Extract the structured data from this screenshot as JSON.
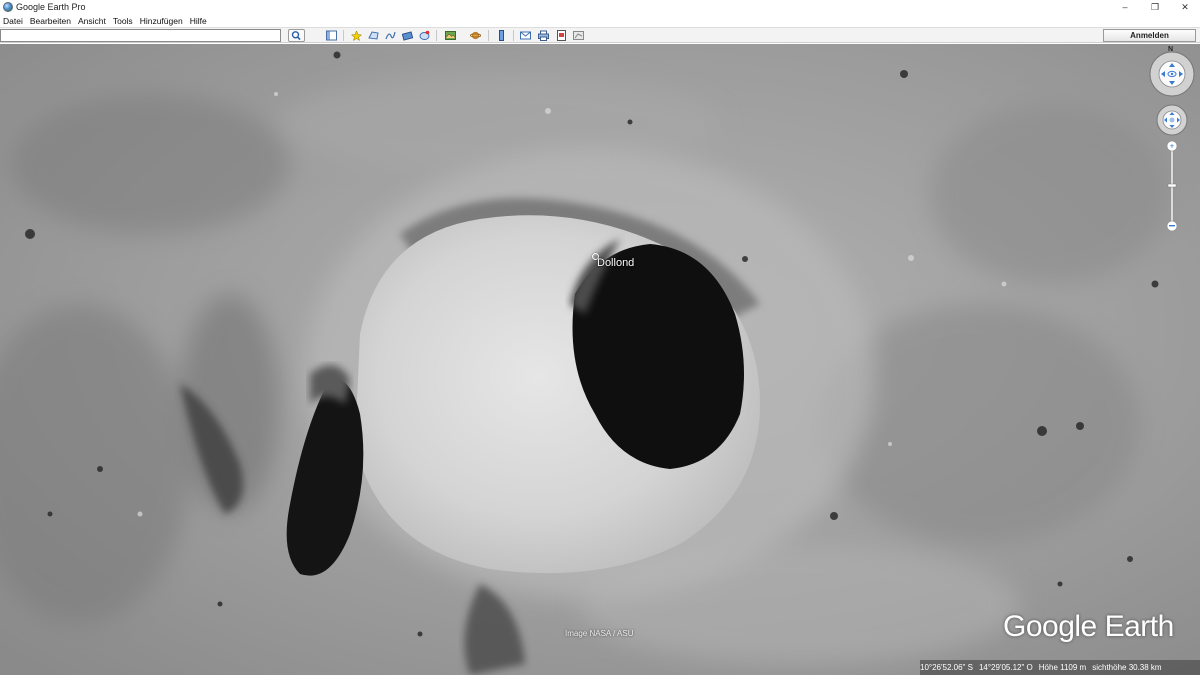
{
  "window": {
    "title": "Google Earth Pro",
    "minimize": "–",
    "maximize": "❐",
    "close": "✕"
  },
  "menu": [
    "Datei",
    "Bearbeiten",
    "Ansicht",
    "Tools",
    "Hinzufügen",
    "Hilfe"
  ],
  "toolbar": {
    "search_value": "",
    "login_label": "Anmelden",
    "buttons": [
      "sidebar-toggle-icon",
      "placemark-icon",
      "polygon-icon",
      "path-icon",
      "image-overlay-icon",
      "tour-record-icon",
      "historical-imagery-icon",
      "sun-icon",
      "planet-icon",
      "ruler-icon",
      "email-icon",
      "print-icon",
      "save-image-icon",
      "maps-icon"
    ]
  },
  "map": {
    "place_label": "Dollond",
    "attribution": "Image NASA / ASU",
    "logo": "Google Earth",
    "compass_north": "N"
  },
  "status": {
    "latitude": "10°26'52.06\" S",
    "longitude": "14°29'05.12\" O",
    "elevation": "Höhe  1109 m",
    "eye_altitude": "sichthöhe  30.38 km"
  },
  "colors": {
    "toolbar_bg": "#f3f3f3",
    "terrain": "#9a9a9a",
    "crater_floor": "#d6d6d6",
    "shadow": "#111111"
  }
}
